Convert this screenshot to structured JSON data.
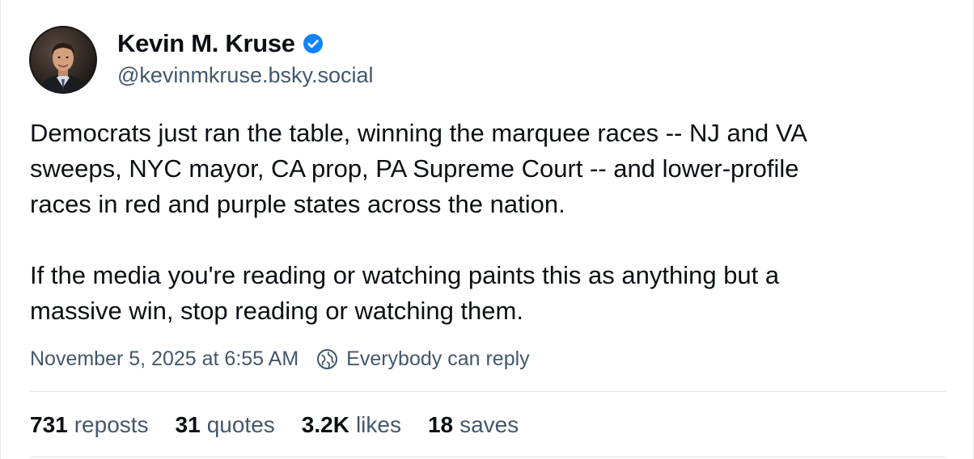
{
  "author": {
    "display_name": "Kevin M. Kruse",
    "handle": "@kevinmkruse.bsky.social",
    "verified": true,
    "verified_color": "#1083fe",
    "avatar_icon": "profile-photo"
  },
  "post": {
    "paragraph_1": {
      "line_1": "Democrats just ran the table, winning the marquee races -- NJ and VA",
      "line_2": "sweeps, NYC mayor, CA prop, PA Supreme Court -- and lower-profile",
      "line_3": "races in red and purple states across the nation."
    },
    "paragraph_2": {
      "line_1": "If the media you're reading or watching paints this as anything but a",
      "line_2": "massive win, stop reading or watching them."
    },
    "timestamp": "November 5, 2025 at 6:55 AM",
    "reply_setting": "Everybody can reply",
    "reply_icon": "globe-icon"
  },
  "stats": {
    "reposts": {
      "count": "731",
      "label": "reposts"
    },
    "quotes": {
      "count": "31",
      "label": "quotes"
    },
    "likes": {
      "count": "3.2K",
      "label": "likes"
    },
    "saves": {
      "count": "18",
      "label": "saves"
    }
  },
  "colors": {
    "text_primary": "#0b0f14",
    "text_secondary": "#42576c",
    "divider": "#dfe4ea"
  }
}
